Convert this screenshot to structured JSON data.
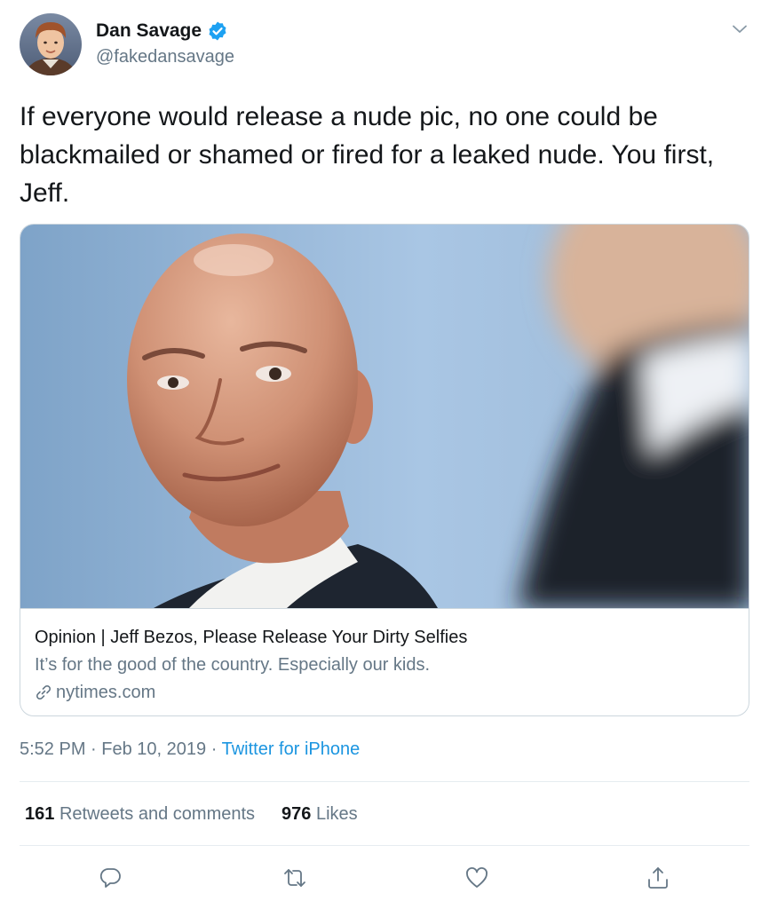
{
  "author": {
    "display_name": "Dan Savage",
    "handle": "@fakedansavage",
    "verified": true,
    "avatar_icon": "child-portrait-avatar"
  },
  "tweet_text": "If everyone would release a nude pic, no one could be blackmailed or shamed or fired for a leaked nude. You first, Jeff.",
  "card": {
    "image_icon": "bald-man-portrait-photo",
    "title": "Opinion | Jeff Bezos, Please Release Your Dirty Selfies",
    "description": "It’s for the good of the country. Especially our kids.",
    "domain": "nytimes.com"
  },
  "meta": {
    "time": "5:52 PM",
    "separator": "·",
    "date": "Feb 10, 2019",
    "source": "Twitter for iPhone"
  },
  "stats": {
    "retweets_count": "161",
    "retweets_label": "Retweets and comments",
    "likes_count": "976",
    "likes_label": "Likes"
  },
  "actions": [
    "reply-icon",
    "retweet-icon",
    "like-icon",
    "share-icon"
  ],
  "colors": {
    "text": "#14171a",
    "secondary": "#657786",
    "accent": "#1b95e0",
    "verified": "#1da1f2",
    "border": "#ccd6dd"
  }
}
